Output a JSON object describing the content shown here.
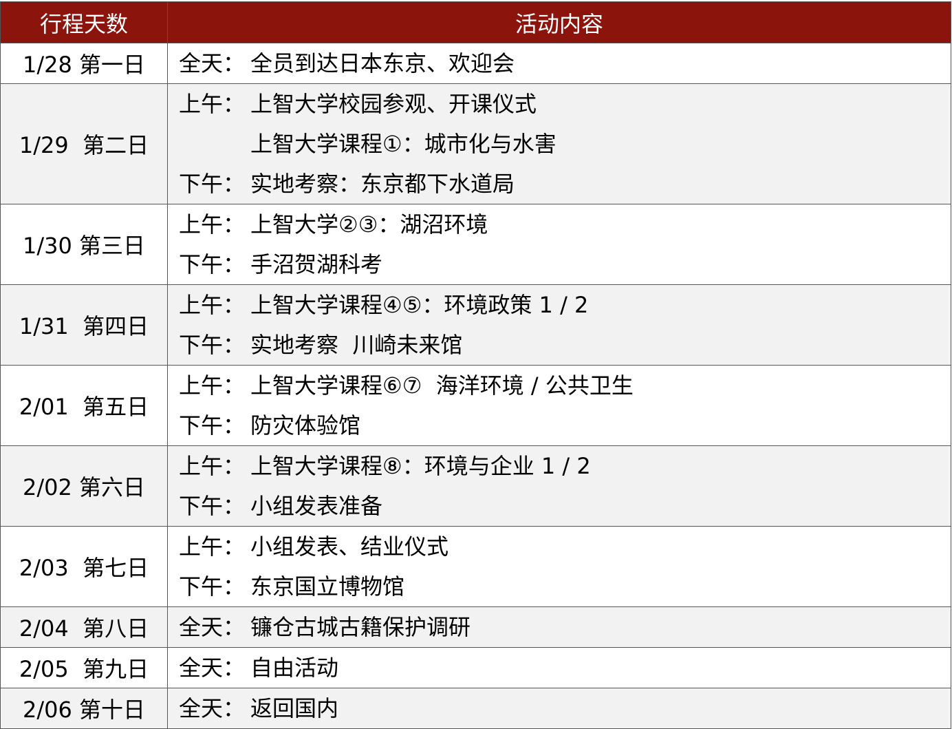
{
  "header": {
    "day_col": "行程天数",
    "activity_col": "活动内容"
  },
  "rows": [
    {
      "day": "1/28 第一日",
      "lines": [
        {
          "label": "全天：",
          "text": "全员到达日本东京、欢迎会"
        }
      ]
    },
    {
      "day": "1/29  第二日",
      "lines": [
        {
          "label": "上午：",
          "text": "上智大学校园参观、开课仪式"
        },
        {
          "label": "",
          "text": "上智大学课程①：城市化与水害"
        },
        {
          "label": "下午：",
          "text": "实地考察：东京都下水道局"
        }
      ]
    },
    {
      "day": "1/30 第三日",
      "lines": [
        {
          "label": "上午：",
          "text": "上智大学②③：湖沼环境"
        },
        {
          "label": "下午：",
          "text": "手沼贺湖科考"
        }
      ]
    },
    {
      "day": "1/31  第四日",
      "lines": [
        {
          "label": "上午：",
          "text": "上智大学课程④⑤：环境政策 1 / 2"
        },
        {
          "label": "下午：",
          "text": "实地考察  川崎未来馆"
        }
      ]
    },
    {
      "day": "2/01  第五日",
      "lines": [
        {
          "label": "上午：",
          "text": "上智大学课程⑥⑦  海洋环境 / 公共卫生"
        },
        {
          "label": "下午：",
          "text": "防灾体验馆"
        }
      ]
    },
    {
      "day": "2/02 第六日",
      "lines": [
        {
          "label": "上午：",
          "text": "上智大学课程⑧：环境与企业 1 / 2"
        },
        {
          "label": "下午：",
          "text": "小组发表准备"
        }
      ]
    },
    {
      "day": "2/03  第七日",
      "lines": [
        {
          "label": "上午：",
          "text": "小组发表、结业仪式"
        },
        {
          "label": "下午：",
          "text": "东京国立博物馆"
        }
      ]
    },
    {
      "day": "2/04  第八日",
      "lines": [
        {
          "label": "全天：",
          "text": "镰仓古城古籍保护调研"
        }
      ]
    },
    {
      "day": "2/05  第九日",
      "lines": [
        {
          "label": "全天：",
          "text": "自由活动"
        }
      ]
    },
    {
      "day": "2/06 第十日",
      "lines": [
        {
          "label": "全天：",
          "text": "返回国内"
        }
      ]
    }
  ],
  "colors": {
    "header_bg": "#8b140c",
    "header_text": "#ffffff",
    "shade_bg": "#f2f2f2",
    "border": "#555555"
  }
}
